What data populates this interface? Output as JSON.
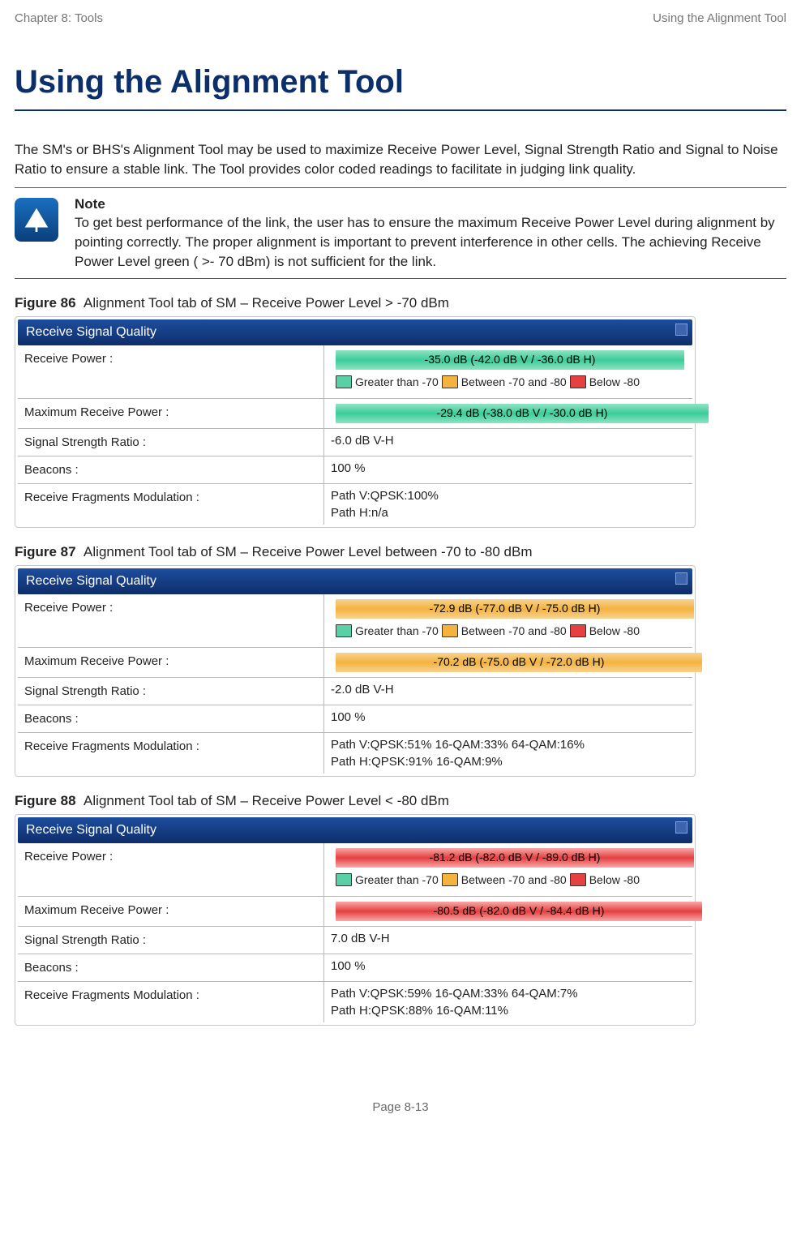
{
  "header": {
    "left": "Chapter 8:  Tools",
    "right": "Using the Alignment Tool"
  },
  "title": "Using the Alignment Tool",
  "intro": "The SM's or BHS's Alignment Tool may be used to maximize Receive Power Level, Signal Strength Ratio and Signal to Noise Ratio to ensure a stable link. The Tool provides color coded readings to facilitate in judging link quality.",
  "note": {
    "title": "Note",
    "body": "To get best performance of the link, the user has to ensure the maximum Receive Power Level during alignment by pointing correctly. The proper alignment is important to prevent interference in other cells. The achieving Receive Power Level green ( >- 70 dBm) is not sufficient for the link."
  },
  "legend": {
    "gt": "Greater than -70",
    "between": "Between -70 and -80",
    "below": "Below -80"
  },
  "labels": {
    "receive_power": "Receive Power :",
    "max_receive_power": "Maximum Receive Power :",
    "ssr": "Signal Strength Ratio :",
    "beacons": "Beacons :",
    "rfm": "Receive Fragments Modulation :"
  },
  "panels": [
    {
      "fig_no": "Figure 86",
      "fig_caption": "Alignment Tool tab of SM – Receive Power Level > -70 dBm",
      "panel_title": "Receive Signal Quality",
      "bar_class": "green",
      "bar2_class": "green2",
      "bar_text": "-35.0 dB (-42.0 dB V / -36.0 dB H)",
      "max_bar_text": "-29.4 dB (-38.0 dB V / -30.0 dB H)",
      "ssr": "-6.0 dB V-H",
      "beacons": "100 %",
      "rfm_line1": "Path V:QPSK:100%",
      "rfm_line2": "Path H:n/a"
    },
    {
      "fig_no": "Figure 87",
      "fig_caption": "Alignment Tool tab of SM – Receive Power Level between -70 to -80 dBm",
      "panel_title": "Receive Signal Quality",
      "bar_class": "orange",
      "bar2_class": "orange2",
      "bar_text": "-72.9 dB (-77.0 dB V / -75.0 dB H)",
      "max_bar_text": "-70.2 dB (-75.0 dB V / -72.0 dB H)",
      "ssr": "-2.0 dB V-H",
      "beacons": "100 %",
      "rfm_line1": "Path V:QPSK:51% 16-QAM:33% 64-QAM:16%",
      "rfm_line2": "Path H:QPSK:91% 16-QAM:9%"
    },
    {
      "fig_no": "Figure 88",
      "fig_caption": "Alignment Tool tab of SM – Receive Power Level < -80 dBm",
      "panel_title": "Receive Signal Quality",
      "bar_class": "red",
      "bar2_class": "red2",
      "bar_text": "-81.2 dB (-82.0 dB V / -89.0 dB H)",
      "max_bar_text": "-80.5 dB (-82.0 dB V / -84.4 dB H)",
      "ssr": "7.0 dB V-H",
      "beacons": "100 %",
      "rfm_line1": "Path V:QPSK:59% 16-QAM:33% 64-QAM:7%",
      "rfm_line2": "Path H:QPSK:88% 16-QAM:11%"
    }
  ],
  "footer": "Page 8-13"
}
